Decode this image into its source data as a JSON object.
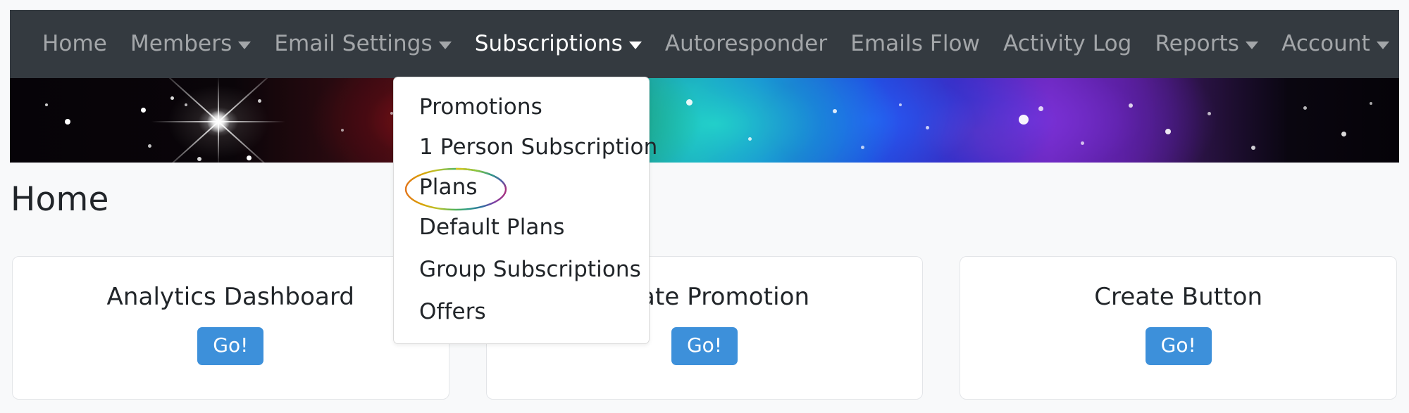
{
  "navbar": {
    "background_color": "#343a40",
    "items": [
      {
        "label": "Home",
        "has_caret": false,
        "active": false
      },
      {
        "label": "Members",
        "has_caret": true,
        "active": false
      },
      {
        "label": "Email Settings",
        "has_caret": true,
        "active": false
      },
      {
        "label": "Subscriptions",
        "has_caret": true,
        "active": true
      },
      {
        "label": "Autoresponder",
        "has_caret": false,
        "active": false
      },
      {
        "label": "Emails Flow",
        "has_caret": false,
        "active": false
      },
      {
        "label": "Activity Log",
        "has_caret": false,
        "active": false
      },
      {
        "label": "Reports",
        "has_caret": true,
        "active": false
      },
      {
        "label": "Account",
        "has_caret": true,
        "active": false
      }
    ]
  },
  "banner": {
    "alt": "space-nebula-banner"
  },
  "page": {
    "title": "Home",
    "background_color": "#f8f9fa"
  },
  "dropdown": {
    "owner": "Subscriptions",
    "open": true,
    "items": [
      {
        "label": "Promotions",
        "highlighted": false
      },
      {
        "label": "1 Person Subscription",
        "highlighted": false
      },
      {
        "label": "Plans",
        "highlighted": true
      },
      {
        "label": "Default Plans",
        "highlighted": false
      },
      {
        "label": "Group Subscriptions",
        "highlighted": false
      },
      {
        "label": "Offers",
        "highlighted": false
      }
    ]
  },
  "highlight": {
    "target": "Plans",
    "shape": "ellipse",
    "stroke_colors": [
      "#e2761b",
      "#d9b400",
      "#8ec63f",
      "#2fa87a",
      "#1f8fb0",
      "#7d3fa8",
      "#a8307e"
    ]
  },
  "cards": [
    {
      "title": "Analytics Dashboard",
      "button_label": "Go!",
      "button_color": "#3d90da"
    },
    {
      "title": "Create Promotion",
      "button_label": "Go!",
      "button_color": "#3d90da"
    },
    {
      "title": "Create Button",
      "button_label": "Go!",
      "button_color": "#3d90da"
    }
  ]
}
